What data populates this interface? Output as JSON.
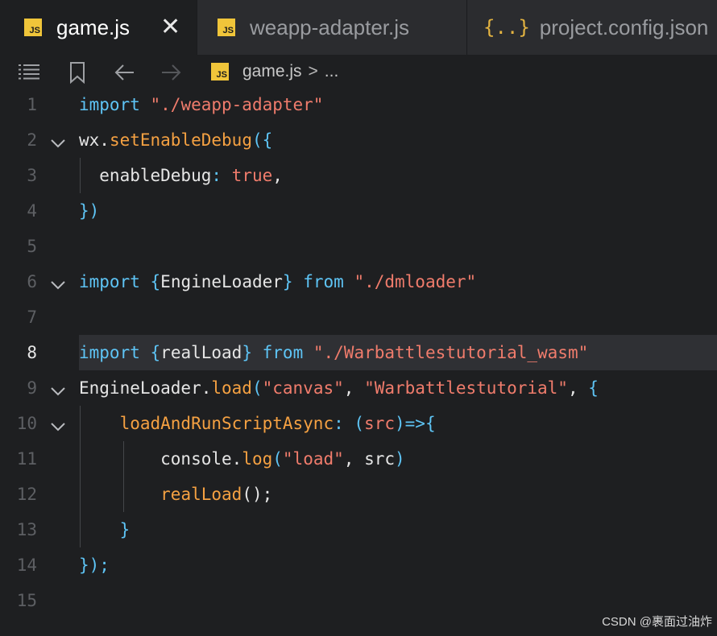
{
  "tabs": [
    {
      "icon": "js-file-icon",
      "icon_text": "JS",
      "label": "game.js",
      "active": true,
      "close": "✕"
    },
    {
      "icon": "js-file-icon",
      "icon_text": "JS",
      "label": "weapp-adapter.js",
      "active": false
    },
    {
      "icon": "json-file-icon",
      "icon_text": "{..}",
      "label": "project.config.json",
      "active": false
    }
  ],
  "toolbar": {
    "icons": [
      "list-icon",
      "bookmark-icon",
      "arrow-left-icon",
      "arrow-right-icon"
    ],
    "breadcrumb": {
      "icon_text": "JS",
      "file": "game.js",
      "separator": ">",
      "more": "..."
    }
  },
  "current_line": 8,
  "code_lines": [
    {
      "n": "1",
      "fold": false,
      "tokens": [
        [
          "import",
          "kw"
        ],
        [
          " ",
          "p"
        ],
        [
          "\"./weapp-adapter\"",
          "str"
        ]
      ]
    },
    {
      "n": "2",
      "fold": true,
      "tokens": [
        [
          "wx",
          "p"
        ],
        [
          ".",
          "p"
        ],
        [
          "setEnableDebug",
          "fn"
        ],
        [
          "({",
          "br"
        ]
      ]
    },
    {
      "n": "3",
      "fold": false,
      "tokens": [
        [
          "  enableDebug",
          "p"
        ],
        [
          ": ",
          "op"
        ],
        [
          "true",
          "bool"
        ],
        [
          ",",
          "p"
        ]
      ]
    },
    {
      "n": "4",
      "fold": false,
      "tokens": [
        [
          "})",
          "br"
        ]
      ]
    },
    {
      "n": "5",
      "fold": false,
      "tokens": []
    },
    {
      "n": "6",
      "fold": true,
      "tokens": [
        [
          "import",
          "kw"
        ],
        [
          " ",
          "p"
        ],
        [
          "{",
          "br"
        ],
        [
          "EngineLoader",
          "p"
        ],
        [
          "}",
          "br"
        ],
        [
          " ",
          "p"
        ],
        [
          "from",
          "kw"
        ],
        [
          " ",
          "p"
        ],
        [
          "\"./dmloader\"",
          "str"
        ]
      ]
    },
    {
      "n": "7",
      "fold": false,
      "tokens": []
    },
    {
      "n": "8",
      "fold": false,
      "tokens": [
        [
          "import",
          "kw"
        ],
        [
          " ",
          "p"
        ],
        [
          "{",
          "br"
        ],
        [
          "realLoad",
          "p"
        ],
        [
          "}",
          "br"
        ],
        [
          " ",
          "p"
        ],
        [
          "from",
          "kw"
        ],
        [
          " ",
          "p"
        ],
        [
          "\"./Warbattlestutorial_wasm\"",
          "str"
        ]
      ]
    },
    {
      "n": "9",
      "fold": true,
      "tokens": [
        [
          "EngineLoader",
          "p"
        ],
        [
          ".",
          "p"
        ],
        [
          "load",
          "fn"
        ],
        [
          "(",
          "br"
        ],
        [
          "\"canvas\"",
          "str"
        ],
        [
          ", ",
          "p"
        ],
        [
          "\"Warbattlestutorial\"",
          "str"
        ],
        [
          ", ",
          "p"
        ],
        [
          "{",
          "br"
        ]
      ]
    },
    {
      "n": "10",
      "fold": true,
      "tokens": [
        [
          "    ",
          "p"
        ],
        [
          "loadAndRunScriptAsync",
          "fn"
        ],
        [
          ": ",
          "op"
        ],
        [
          "(",
          "br"
        ],
        [
          "src",
          "param"
        ],
        [
          ")",
          "br"
        ],
        [
          "=>",
          "op"
        ],
        [
          "{",
          "br"
        ]
      ]
    },
    {
      "n": "11",
      "fold": false,
      "tokens": [
        [
          "        console",
          "p"
        ],
        [
          ".",
          "p"
        ],
        [
          "log",
          "fn"
        ],
        [
          "(",
          "br"
        ],
        [
          "\"load\"",
          "str"
        ],
        [
          ", ",
          "p"
        ],
        [
          "src",
          "p"
        ],
        [
          ")",
          "br"
        ]
      ]
    },
    {
      "n": "12",
      "fold": false,
      "tokens": [
        [
          "        ",
          "p"
        ],
        [
          "realLoad",
          "fn"
        ],
        [
          "();",
          "p"
        ]
      ]
    },
    {
      "n": "13",
      "fold": false,
      "tokens": [
        [
          "    ",
          "p"
        ],
        [
          "}",
          "br"
        ]
      ]
    },
    {
      "n": "14",
      "fold": false,
      "tokens": [
        [
          "});",
          "br"
        ]
      ]
    },
    {
      "n": "15",
      "fold": false,
      "tokens": []
    }
  ],
  "colors": {
    "kw": "#5ec4f5",
    "str": "#f07c6c",
    "fn": "#f5a142",
    "br": "#5ec4f5",
    "op": "#5ec4f5",
    "bool": "#f07c6c",
    "param": "#f07c6c",
    "p": "#e6e6e6"
  },
  "watermark": "CSDN @裹面过油炸"
}
